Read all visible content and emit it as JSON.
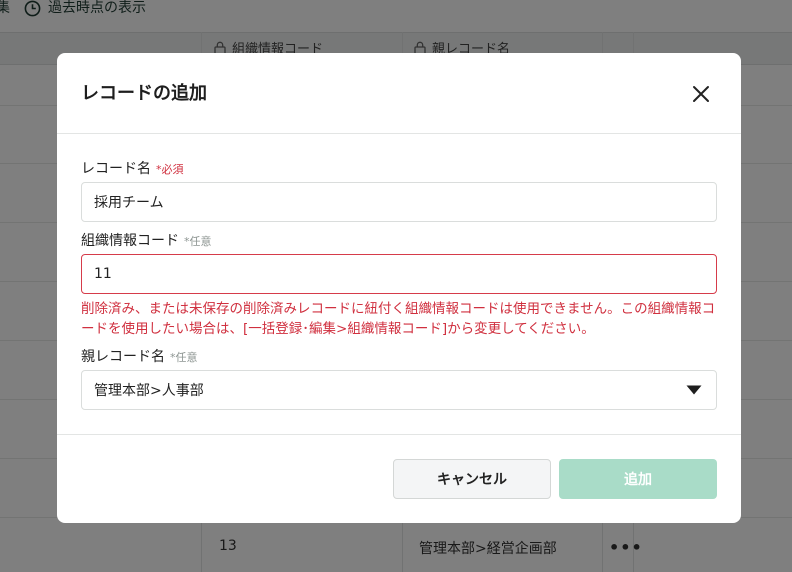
{
  "background": {
    "toolbar": {
      "partial_label": "集",
      "history_label": "過去時点の表示"
    },
    "columns": {
      "org_code": "組織情報コード",
      "parent_name": "親レコード名"
    },
    "visible_row": {
      "org_code": "13",
      "parent_name": "管理本部>経営企画部",
      "menu": "•••"
    }
  },
  "modal": {
    "title": "レコードの追加",
    "fields": {
      "record_name": {
        "label": "レコード名",
        "badge": "*必須",
        "value": "採用チーム"
      },
      "org_code": {
        "label": "組織情報コード",
        "badge": "*任意",
        "value": "11",
        "error": "削除済み、または未保存の削除済みレコードに紐付く組織情報コードは使用できません。この組織情報コードを使用したい場合は、[一括登録･編集>組織情報コード]から変更してください。"
      },
      "parent_record": {
        "label": "親レコード名",
        "badge": "*任意",
        "value": "管理本部>人事部"
      }
    },
    "buttons": {
      "cancel": "キャンセル",
      "add": "追加"
    }
  },
  "colors": {
    "accent_disabled": "#a9dcc8",
    "error": "#d0303f",
    "overlay": "rgba(0,0,0,0.5)"
  },
  "icons": [
    "clock-icon",
    "lock-icon",
    "close-icon",
    "caret-down-icon",
    "more-icon"
  ]
}
